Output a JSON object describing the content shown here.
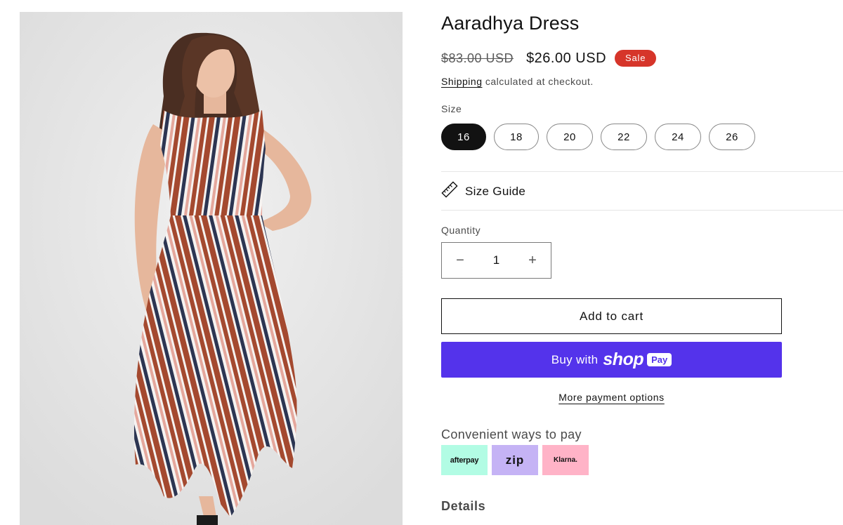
{
  "product": {
    "title": "Aaradhya Dress",
    "image_alt": "Aaradhya Dress product photo",
    "price_regular": "$83.00 USD",
    "price_sale": "$26.00 USD",
    "sale_badge": "Sale"
  },
  "shipping": {
    "link_text": "Shipping",
    "text": " calculated at checkout."
  },
  "size": {
    "label": "Size",
    "selected": "16",
    "options": [
      "16",
      "18",
      "20",
      "22",
      "24",
      "26"
    ]
  },
  "size_guide": {
    "label": "Size Guide",
    "icon": "ruler-icon"
  },
  "quantity": {
    "label": "Quantity",
    "value": "1",
    "minus": "−",
    "plus": "+"
  },
  "buttons": {
    "add_to_cart": "Add to cart",
    "buy_with": "Buy with",
    "shop_word": "shop",
    "pay_chip": "Pay",
    "more_payment_options": "More payment options"
  },
  "payment": {
    "heading": "Convenient ways to pay",
    "methods": [
      "afterpay",
      "zip",
      "Klarna."
    ]
  },
  "details": {
    "heading": "Details"
  },
  "colors": {
    "sale_badge": "#d6352a",
    "shop_pay": "#5433eb",
    "afterpay": "#b2fce4",
    "zip": "#c5b3f5",
    "klarna": "#ffb3c7"
  }
}
